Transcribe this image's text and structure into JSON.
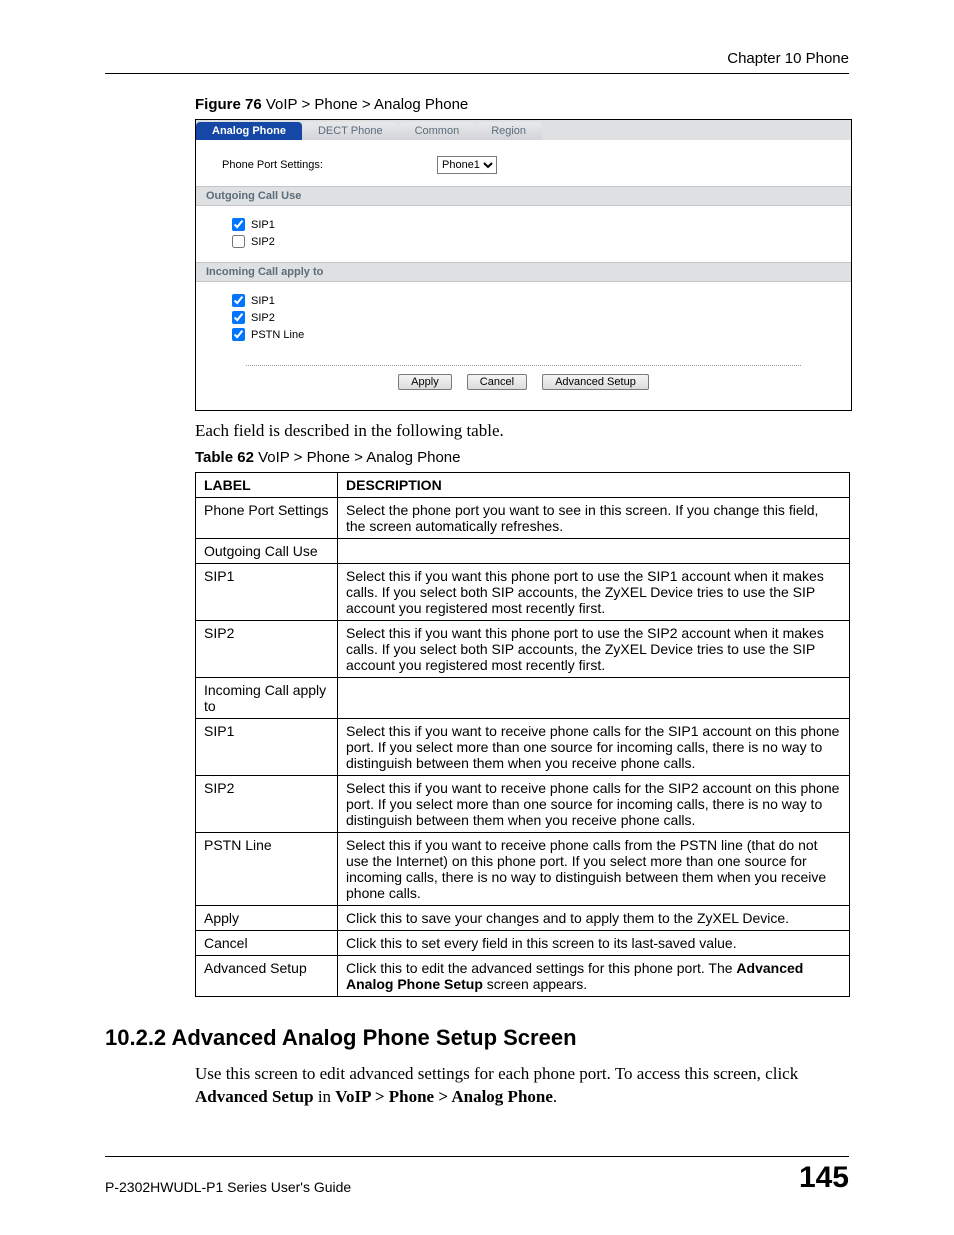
{
  "chapter": "Chapter 10 Phone",
  "figure_caption_bold": "Figure 76",
  "figure_caption_rest": "   VoIP > Phone > Analog Phone",
  "figure": {
    "tabs": [
      "Analog Phone",
      "DECT Phone",
      "Common",
      "Region"
    ],
    "phone_port_label": "Phone Port Settings:",
    "phone_port_value": "Phone1",
    "outgoing_header": "Outgoing Call Use",
    "outgoing_items": [
      {
        "label": "SIP1",
        "checked": true
      },
      {
        "label": "SIP2",
        "checked": false
      }
    ],
    "incoming_header": "Incoming Call apply to",
    "incoming_items": [
      {
        "label": "SIP1",
        "checked": true
      },
      {
        "label": "SIP2",
        "checked": true
      },
      {
        "label": "PSTN Line",
        "checked": true
      }
    ],
    "buttons": {
      "apply": "Apply",
      "cancel": "Cancel",
      "adv": "Advanced Setup"
    }
  },
  "intro_text": "Each field is described in the following table.",
  "table_caption_bold": "Table 62",
  "table_caption_rest": "   VoIP > Phone > Analog Phone",
  "table": {
    "head": {
      "label": "LABEL",
      "desc": "DESCRIPTION"
    },
    "rows": [
      {
        "label": "Phone Port Settings",
        "desc": "Select the phone port you want to see in this screen. If you change this field, the screen automatically refreshes."
      },
      {
        "label": "Outgoing Call Use",
        "desc": ""
      },
      {
        "label": "SIP1",
        "desc": "Select this if you want this phone port to use the SIP1 account when it makes calls. If you select both SIP accounts, the ZyXEL Device tries to use the SIP account you registered most recently first."
      },
      {
        "label": "SIP2",
        "desc": "Select this if you want this phone port to use the SIP2 account when it makes calls. If you select both SIP accounts, the ZyXEL Device tries to use the SIP account you registered most recently first."
      },
      {
        "label": "Incoming Call apply to",
        "desc": ""
      },
      {
        "label": "SIP1",
        "desc": "Select this if you want to receive phone calls for the SIP1 account on this phone port. If you select more than one source for incoming calls, there is no way to distinguish between them when you receive phone calls."
      },
      {
        "label": "SIP2",
        "desc": "Select this if you want to receive phone calls for the SIP2 account on this phone port. If you select more than one source for incoming calls, there is no way to distinguish between them when you receive phone calls."
      },
      {
        "label": "PSTN Line",
        "desc": "Select this if you want to receive phone calls from the PSTN line (that do not use the Internet) on this phone port. If you select more than one source for incoming calls, there is no way to distinguish between them when you receive phone calls."
      },
      {
        "label": "Apply",
        "desc": "Click this to save your changes and to apply them to the ZyXEL Device."
      },
      {
        "label": "Cancel",
        "desc": "Click this to set every field in this screen to its last-saved value."
      }
    ],
    "adv_row": {
      "label": "Advanced Setup",
      "desc_pre": "Click this to edit the advanced settings for this phone port. The ",
      "desc_bold": "Advanced Analog Phone Setup",
      "desc_post": " screen appears."
    }
  },
  "section": {
    "heading": "10.2.2  Advanced Analog Phone Setup Screen",
    "body_pre": "Use this screen to edit advanced settings for each phone port. To access this screen, click ",
    "body_b1": "Advanced Setup",
    "body_mid": " in ",
    "body_b2": "VoIP > Phone > Analog Phone",
    "body_post": "."
  },
  "footer": {
    "left": "P-2302HWUDL-P1 Series User's Guide",
    "right": "145"
  }
}
